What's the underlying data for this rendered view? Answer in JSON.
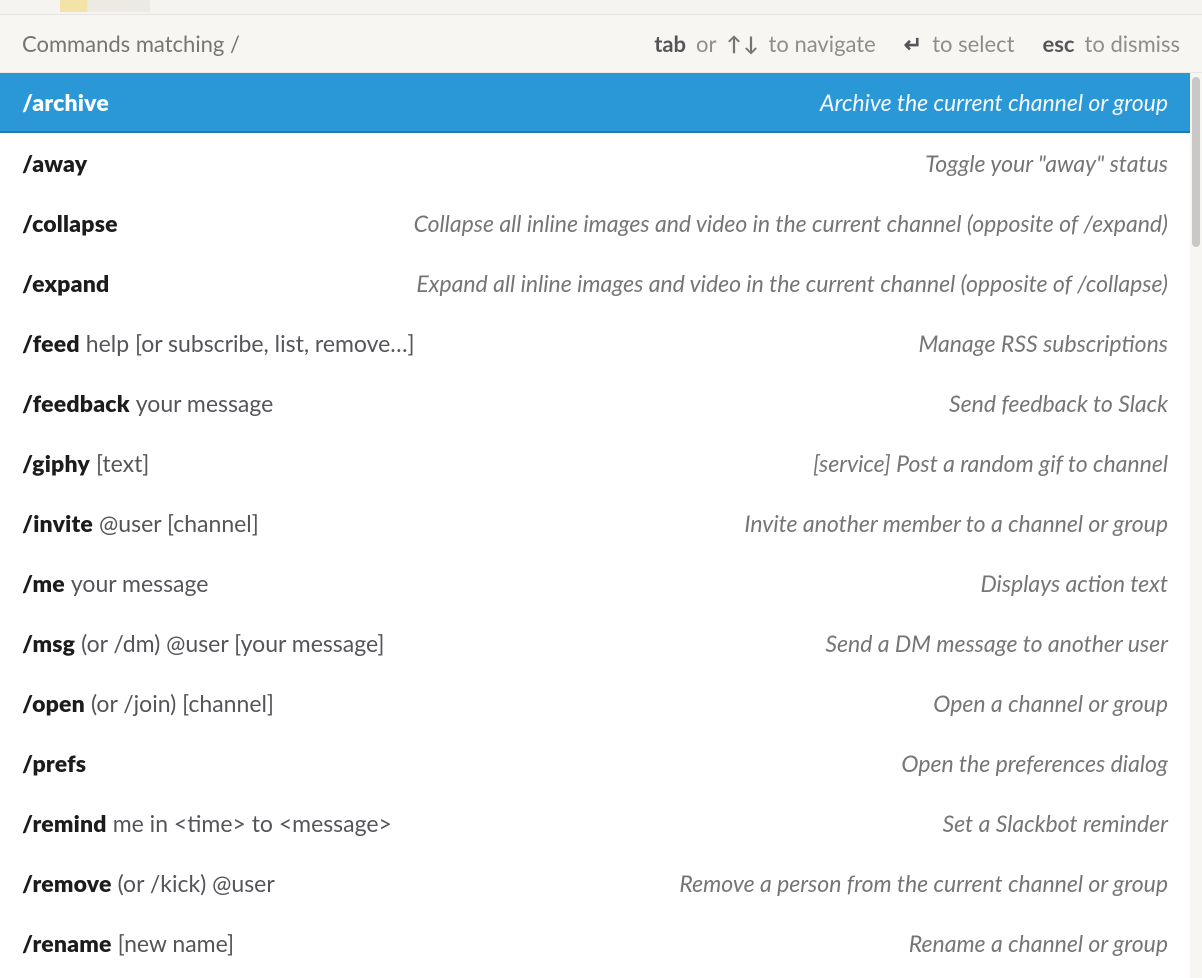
{
  "header": {
    "title_prefix": "Commands matching",
    "title_query": "/",
    "hints": {
      "tab": "tab",
      "or": "or",
      "navigate": "to navigate",
      "select": "to select",
      "esc": "esc",
      "dismiss": "to dismiss"
    }
  },
  "commands": [
    {
      "cmd": "/archive",
      "args": "",
      "desc": "Archive the current channel or group",
      "selected": true
    },
    {
      "cmd": "/away",
      "args": "",
      "desc": "Toggle your \"away\" status"
    },
    {
      "cmd": "/collapse",
      "args": "",
      "desc": "Collapse all inline images and video in the current channel (opposite of /expand)"
    },
    {
      "cmd": "/expand",
      "args": "",
      "desc": "Expand all inline images and video in the current channel (opposite of /collapse)"
    },
    {
      "cmd": "/feed",
      "args": "help [or subscribe, list, remove…]",
      "desc": "Manage RSS subscriptions"
    },
    {
      "cmd": "/feedback",
      "args": "your message",
      "desc": "Send feedback to Slack"
    },
    {
      "cmd": "/giphy",
      "args": "[text]",
      "desc": "[service] Post a random gif to channel"
    },
    {
      "cmd": "/invite",
      "args": "@user [channel]",
      "desc": "Invite another member to a channel or group"
    },
    {
      "cmd": "/me",
      "args": "your message",
      "desc": "Displays action text"
    },
    {
      "cmd": "/msg",
      "args": "(or /dm) @user [your message]",
      "desc": "Send a DM message to another user"
    },
    {
      "cmd": "/open",
      "args": "(or /join) [channel]",
      "desc": "Open a channel or group"
    },
    {
      "cmd": "/prefs",
      "args": "",
      "desc": "Open the preferences dialog"
    },
    {
      "cmd": "/remind",
      "args": "me in <time> to <message>",
      "desc": "Set a Slackbot reminder"
    },
    {
      "cmd": "/remove",
      "args": "(or /kick) @user",
      "desc": "Remove a person from the current channel or group"
    },
    {
      "cmd": "/rename",
      "args": "[new name]",
      "desc": "Rename a channel or group"
    }
  ]
}
